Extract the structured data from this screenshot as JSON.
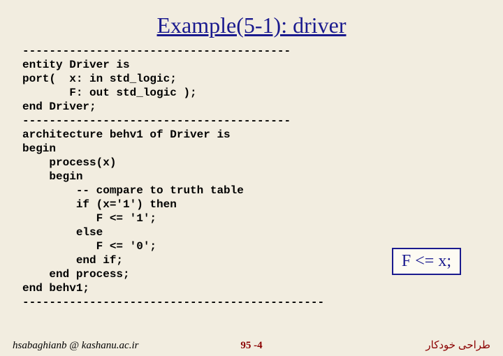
{
  "title": "Example(5-1): driver",
  "code": "----------------------------------------\nentity Driver is\nport(  x: in std_logic;\n       F: out std_logic );\nend Driver;\n----------------------------------------\narchitecture behv1 of Driver is\nbegin\n    process(x)\n    begin\n        -- compare to truth table\n        if (x='1') then\n           F <= '1';\n        else\n           F <= '0';\n        end if;\n    end process;\nend behv1;\n---------------------------------------------",
  "callout": "F <= x;",
  "footer": {
    "left": "hsabaghianb @ kashanu.ac.ir",
    "center": "95 -4",
    "right": "طراحی خودکار"
  }
}
